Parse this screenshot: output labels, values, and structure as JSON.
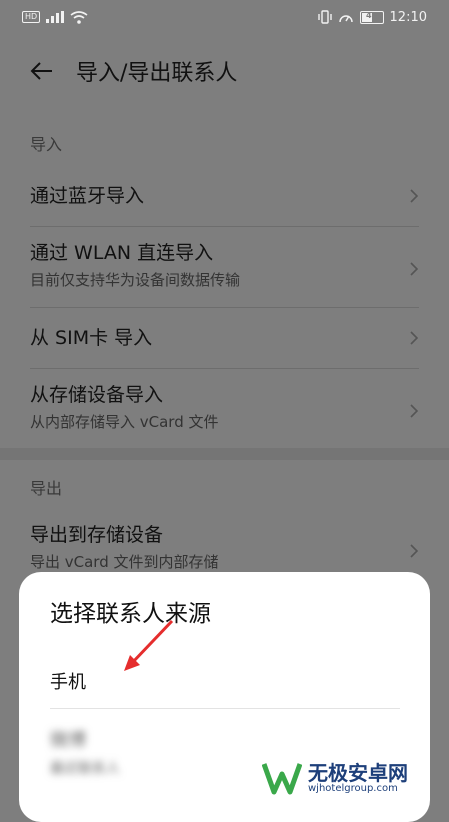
{
  "status_bar": {
    "time": "12:10",
    "battery": "49"
  },
  "app_bar": {
    "title": "导入/导出联系人"
  },
  "import_section": {
    "label": "导入",
    "items": [
      {
        "title": "通过蓝牙导入"
      },
      {
        "title": "通过 WLAN 直连导入",
        "subtitle": "目前仅支持华为设备间数据传输"
      },
      {
        "title": "从 SIM卡 导入"
      },
      {
        "title": "从存储设备导入",
        "subtitle": "从内部存储导入 vCard 文件"
      }
    ]
  },
  "export_section": {
    "label": "导出",
    "items": [
      {
        "title": "导出到存储设备",
        "subtitle": "导出 vCard 文件到内部存储"
      }
    ]
  },
  "sheet": {
    "title": "选择联系人来源",
    "options": [
      {
        "label": "手机"
      },
      {
        "label": "微博",
        "subtitle": "最近联系人"
      }
    ]
  },
  "annotation": {
    "arrow_color": "#e52d2d"
  },
  "watermark": {
    "name": "无极安卓网",
    "url": "wjhotelgroup.com"
  }
}
